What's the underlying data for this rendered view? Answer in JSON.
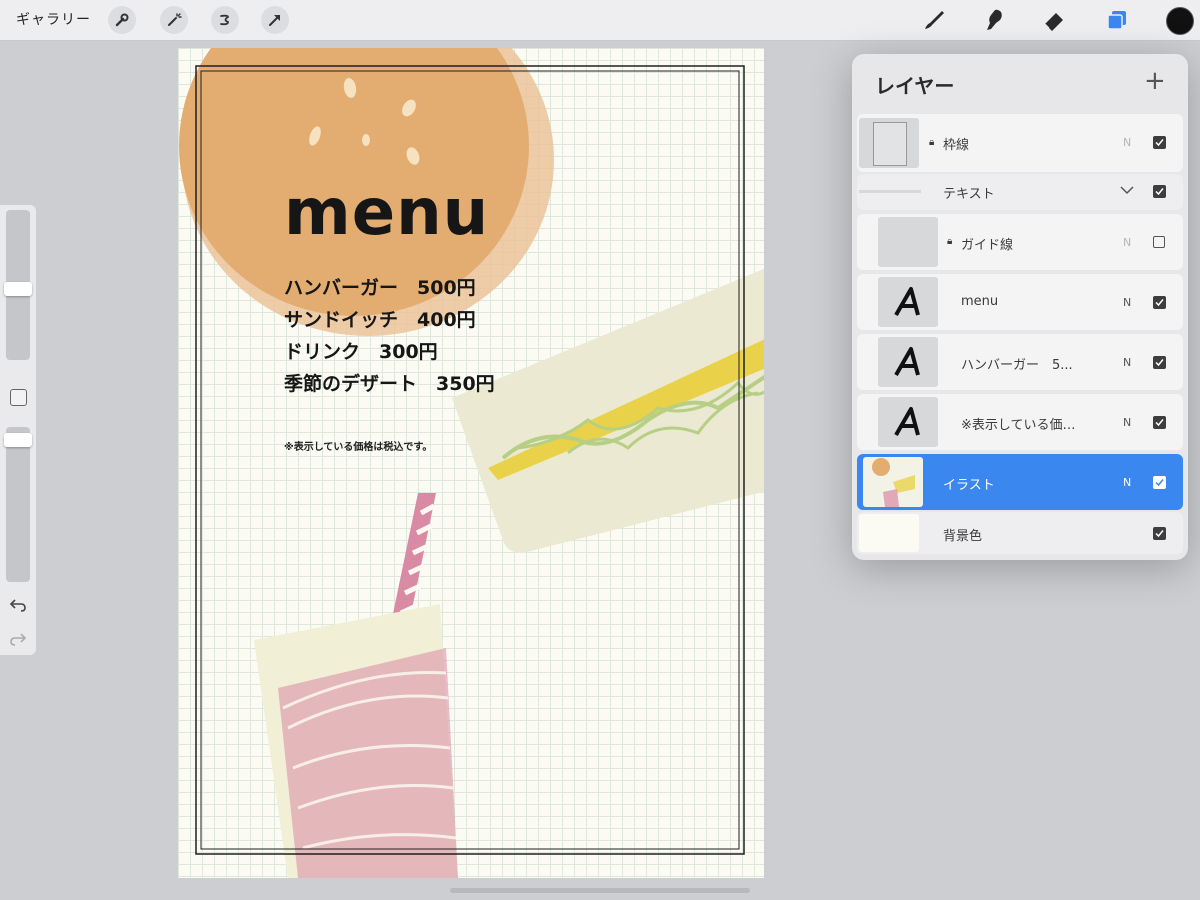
{
  "toolbar": {
    "gallery_label": "ギャラリー",
    "left_tools": [
      "wrench-icon",
      "magic-wand-icon",
      "selection-icon",
      "transform-arrow-icon"
    ],
    "right_tools": [
      "brush-icon",
      "smudge-icon",
      "eraser-icon",
      "layers-icon"
    ],
    "active_tool": "layers-icon",
    "accent_color": "#3b87f0",
    "current_color": "#111111"
  },
  "sidebar": {
    "brush_size_level": 0.58,
    "opacity_level": 0.95,
    "icons": [
      "modify-square-icon",
      "undo-icon",
      "redo-icon"
    ]
  },
  "canvas": {
    "title": "menu",
    "items": [
      "ハンバーガー　500円",
      "サンドイッチ　400円",
      "ドリンク　300円",
      "季節のデザート　350円"
    ],
    "note": "※表示している価格は税込です。",
    "colors": {
      "paper": "#fbfbf4",
      "bun": "#e3ad72",
      "sandwich_bread": "#ebe9d2",
      "egg": "#e9d24a",
      "lettuce": "#b7cf84",
      "drink": "#d98aa4",
      "straw": "#d98aa4"
    }
  },
  "layers_panel": {
    "title": "レイヤー",
    "add_icon": "plus-icon",
    "layers": [
      {
        "name": "枠線",
        "mode": "N",
        "visible": true,
        "locked": true,
        "selected": false
      },
      {
        "name": "テキスト",
        "group": true,
        "visible": true,
        "collapsed": false
      },
      {
        "name": "ガイド線",
        "mode": "N",
        "visible": false,
        "locked": true,
        "selected": false
      },
      {
        "name": "menu",
        "mode": "N",
        "visible": true,
        "text": true
      },
      {
        "name": "ハンバーガー　5...",
        "mode": "N",
        "visible": true,
        "text": true
      },
      {
        "name": "※表示している価…",
        "mode": "N",
        "visible": true,
        "text": true
      },
      {
        "name": "イラスト",
        "mode": "N",
        "visible": true,
        "selected": true
      },
      {
        "name": "背景色",
        "visible": true,
        "selected": false
      }
    ]
  }
}
